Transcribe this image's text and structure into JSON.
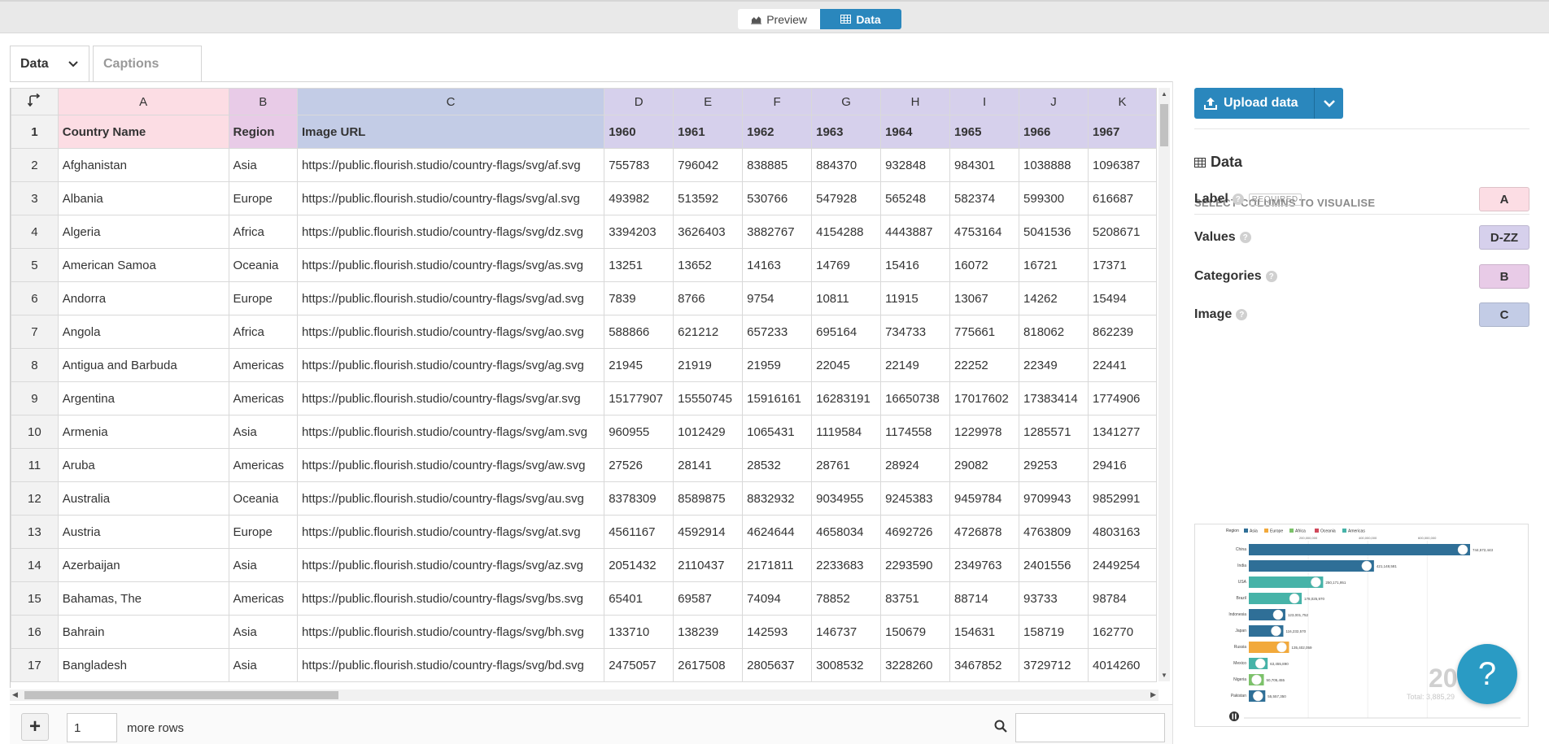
{
  "mode_switch": {
    "preview_label": "Preview",
    "data_label": "Data"
  },
  "sheet_tabs": {
    "data_label": "Data",
    "captions_label": "Captions"
  },
  "grid": {
    "columns": [
      "A",
      "B",
      "C",
      "D",
      "E",
      "F",
      "G",
      "H",
      "I",
      "J",
      "K"
    ],
    "headers": [
      "Country Name",
      "Region",
      "Image URL",
      "1960",
      "1961",
      "1962",
      "1963",
      "1964",
      "1965",
      "1966",
      "1967"
    ],
    "rows": [
      {
        "num": "2",
        "cells": [
          "Afghanistan",
          "Asia",
          "https://public.flourish.studio/country-flags/svg/af.svg",
          "755783",
          "796042",
          "838885",
          "884370",
          "932848",
          "984301",
          "1038888",
          "1096387"
        ]
      },
      {
        "num": "3",
        "cells": [
          "Albania",
          "Europe",
          "https://public.flourish.studio/country-flags/svg/al.svg",
          "493982",
          "513592",
          "530766",
          "547928",
          "565248",
          "582374",
          "599300",
          "616687"
        ]
      },
      {
        "num": "4",
        "cells": [
          "Algeria",
          "Africa",
          "https://public.flourish.studio/country-flags/svg/dz.svg",
          "3394203",
          "3626403",
          "3882767",
          "4154288",
          "4443887",
          "4753164",
          "5041536",
          "5208671"
        ]
      },
      {
        "num": "5",
        "cells": [
          "American Samoa",
          "Oceania",
          "https://public.flourish.studio/country-flags/svg/as.svg",
          "13251",
          "13652",
          "14163",
          "14769",
          "15416",
          "16072",
          "16721",
          "17371"
        ]
      },
      {
        "num": "6",
        "wrap": true,
        "cells": [
          "Andorra",
          "Europe",
          "https://public.flourish.studio/country-flags/svg/ad.svg",
          "7839",
          "8766",
          "9754",
          "10811",
          "11915",
          "13067",
          "14262",
          "15494"
        ]
      },
      {
        "num": "7",
        "cells": [
          "Angola",
          "Africa",
          "https://public.flourish.studio/country-flags/svg/ao.svg",
          "588866",
          "621212",
          "657233",
          "695164",
          "734733",
          "775661",
          "818062",
          "862239"
        ]
      },
      {
        "num": "8",
        "cells": [
          "Antigua and Barbuda",
          "Americas",
          "https://public.flourish.studio/country-flags/svg/ag.svg",
          "21945",
          "21919",
          "21959",
          "22045",
          "22149",
          "22252",
          "22349",
          "22441"
        ]
      },
      {
        "num": "9",
        "cells": [
          "Argentina",
          "Americas",
          "https://public.flourish.studio/country-flags/svg/ar.svg",
          "15177907",
          "15550745",
          "15916161",
          "16283191",
          "16650738",
          "17017602",
          "17383414",
          "1774906"
        ]
      },
      {
        "num": "10",
        "wrap": true,
        "cells": [
          "Armenia",
          "Asia",
          "https://public.flourish.studio/country-flags/svg/am.svg",
          "960955",
          "1012429",
          "1065431",
          "1119584",
          "1174558",
          "1229978",
          "1285571",
          "1341277"
        ]
      },
      {
        "num": "11",
        "wrap": true,
        "cells": [
          "Aruba",
          "Americas",
          "https://public.flourish.studio/country-flags/svg/aw.svg",
          "27526",
          "28141",
          "28532",
          "28761",
          "28924",
          "29082",
          "29253",
          "29416"
        ]
      },
      {
        "num": "12",
        "cells": [
          "Australia",
          "Oceania",
          "https://public.flourish.studio/country-flags/svg/au.svg",
          "8378309",
          "8589875",
          "8832932",
          "9034955",
          "9245383",
          "9459784",
          "9709943",
          "9852991"
        ]
      },
      {
        "num": "13",
        "cells": [
          "Austria",
          "Europe",
          "https://public.flourish.studio/country-flags/svg/at.svg",
          "4561167",
          "4592914",
          "4624644",
          "4658034",
          "4692726",
          "4726878",
          "4763809",
          "4803163"
        ]
      },
      {
        "num": "14",
        "cells": [
          "Azerbaijan",
          "Asia",
          "https://public.flourish.studio/country-flags/svg/az.svg",
          "2051432",
          "2110437",
          "2171811",
          "2233683",
          "2293590",
          "2349763",
          "2401556",
          "2449254"
        ]
      },
      {
        "num": "15",
        "cells": [
          "Bahamas, The",
          "Americas",
          "https://public.flourish.studio/country-flags/svg/bs.svg",
          "65401",
          "69587",
          "74094",
          "78852",
          "83751",
          "88714",
          "93733",
          "98784"
        ]
      },
      {
        "num": "16",
        "wrap": true,
        "cells": [
          "Bahrain",
          "Asia",
          "https://public.flourish.studio/country-flags/svg/bh.svg",
          "133710",
          "138239",
          "142593",
          "146737",
          "150679",
          "154631",
          "158719",
          "162770"
        ]
      },
      {
        "num": "17",
        "wrap": true,
        "cells": [
          "Bangladesh",
          "Asia",
          "https://public.flourish.studio/country-flags/svg/bd.svg",
          "2475057",
          "2617508",
          "2805637",
          "3008532",
          "3228260",
          "3467852",
          "3729712",
          "4014260"
        ]
      }
    ]
  },
  "bottom": {
    "rows_value": "1",
    "more_rows_label": "more rows"
  },
  "panel": {
    "upload_label": "Upload data",
    "section_title": "Data",
    "select_label": "SELECT COLUMNS TO VISUALISE",
    "bindings": [
      {
        "label": "Label",
        "required": "REQUIRED",
        "chip": "A",
        "color": "#fcdde4"
      },
      {
        "label": "Values",
        "required": "",
        "chip": "D-ZZ",
        "color": "#d6d0ec"
      },
      {
        "label": "Categories",
        "required": "",
        "chip": "B",
        "color": "#e8cbe7"
      },
      {
        "label": "Image",
        "required": "",
        "chip": "C",
        "color": "#c3cce6"
      }
    ]
  },
  "preview_thumbnail": {
    "legend_title": "Region",
    "legend": [
      {
        "name": "Asia",
        "color": "#2f6f97"
      },
      {
        "name": "Europe",
        "color": "#f2a93b"
      },
      {
        "name": "Africa",
        "color": "#7cc26a"
      },
      {
        "name": "Oceania",
        "color": "#d1495b"
      },
      {
        "name": "Americas",
        "color": "#46b3a8"
      }
    ],
    "axis_ticks": [
      "200,000,000",
      "400,000,000",
      "600,000,000"
    ],
    "bars": [
      {
        "label": "China",
        "value": 744572443,
        "value_label": "744,572,443",
        "color": "#2f6f97"
      },
      {
        "label": "India",
        "value": 421148581,
        "value_label": "421,148,581",
        "color": "#2f6f97"
      },
      {
        "label": "USA",
        "value": 250171951,
        "value_label": "250,171,951",
        "color": "#46b3a8"
      },
      {
        "label": "Brazil",
        "value": 178025970,
        "value_label": "178,025,970",
        "color": "#46b3a8"
      },
      {
        "label": "Indonesia",
        "value": 123001752,
        "value_label": "123,001,752",
        "color": "#2f6f97"
      },
      {
        "label": "Japan",
        "value": 116232570,
        "value_label": "116,232,570",
        "color": "#2f6f97"
      },
      {
        "label": "Russia",
        "value": 135402059,
        "value_label": "135,402,059",
        "color": "#f2a93b"
      },
      {
        "label": "Mexico",
        "value": 63455890,
        "value_label": "63,455,890",
        "color": "#46b3a8"
      },
      {
        "label": "Nigeria",
        "value": 50705455,
        "value_label": "50,705,455",
        "color": "#7cc26a"
      },
      {
        "label": "Pakistan",
        "value": 55557350,
        "value_label": "55,557,350",
        "color": "#2f6f97"
      }
    ],
    "year_text": "20",
    "total_text": "Total: 3,885,29"
  },
  "colors": {
    "accent": "#2a87bd",
    "help": "#2a9bc4"
  }
}
